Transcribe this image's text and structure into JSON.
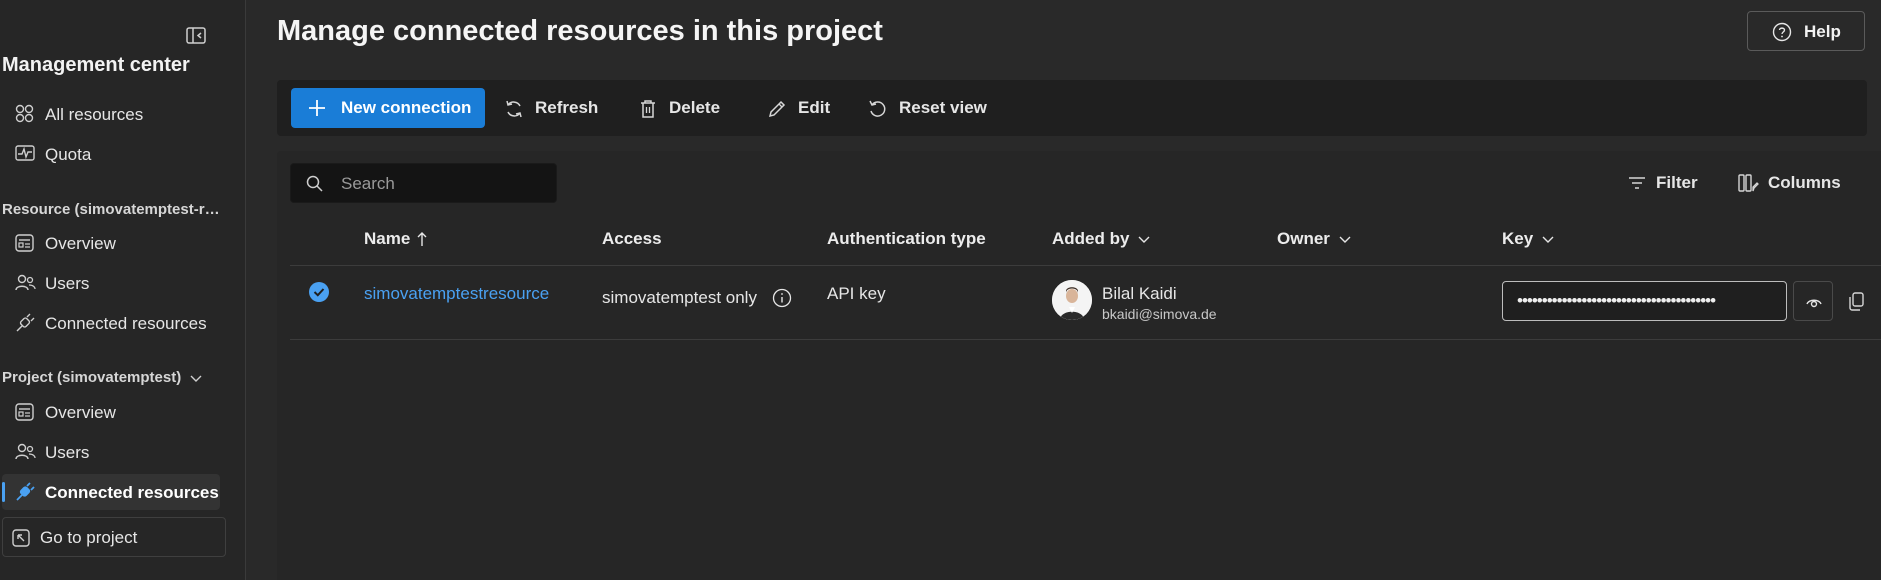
{
  "sidebar": {
    "title": "Management center",
    "top_items": [
      {
        "label": "All resources",
        "icon": "grid-icon"
      },
      {
        "label": "Quota",
        "icon": "pulse-chart-icon"
      }
    ],
    "resource_section": {
      "label": "Resource (simovatemptest-res...",
      "items": [
        {
          "label": "Overview",
          "icon": "overview-icon"
        },
        {
          "label": "Users",
          "icon": "users-icon"
        },
        {
          "label": "Connected resources",
          "icon": "plug-icon"
        }
      ]
    },
    "project_section": {
      "label": "Project (simovatemptest)",
      "items": [
        {
          "label": "Overview",
          "icon": "overview-icon"
        },
        {
          "label": "Users",
          "icon": "users-icon"
        },
        {
          "label": "Connected resources",
          "icon": "plug-icon",
          "active": true
        }
      ]
    },
    "goto_label": "Go to project"
  },
  "header": {
    "title": "Manage connected resources in this project",
    "help_label": "Help"
  },
  "toolbar": {
    "new_connection": "New connection",
    "refresh": "Refresh",
    "delete": "Delete",
    "edit": "Edit",
    "reset_view": "Reset view"
  },
  "table_controls": {
    "search_placeholder": "Search",
    "filter": "Filter",
    "columns": "Columns"
  },
  "columns": {
    "name": "Name",
    "access": "Access",
    "auth_type": "Authentication type",
    "added_by": "Added by",
    "owner": "Owner",
    "key": "Key"
  },
  "rows": [
    {
      "name": "simovatemptestresource",
      "access": "simovatemptest only",
      "auth_type": "API key",
      "added_by_name": "Bilal Kaidi",
      "added_by_email": "bkaidi@simova.de",
      "owner": "",
      "key_masked": "••••••••••••••••••••••••••••••••••••••••",
      "selected": true
    }
  ],
  "colors": {
    "accent": "#1a7dd7",
    "link": "#4aa1f2",
    "background": "#292929"
  }
}
